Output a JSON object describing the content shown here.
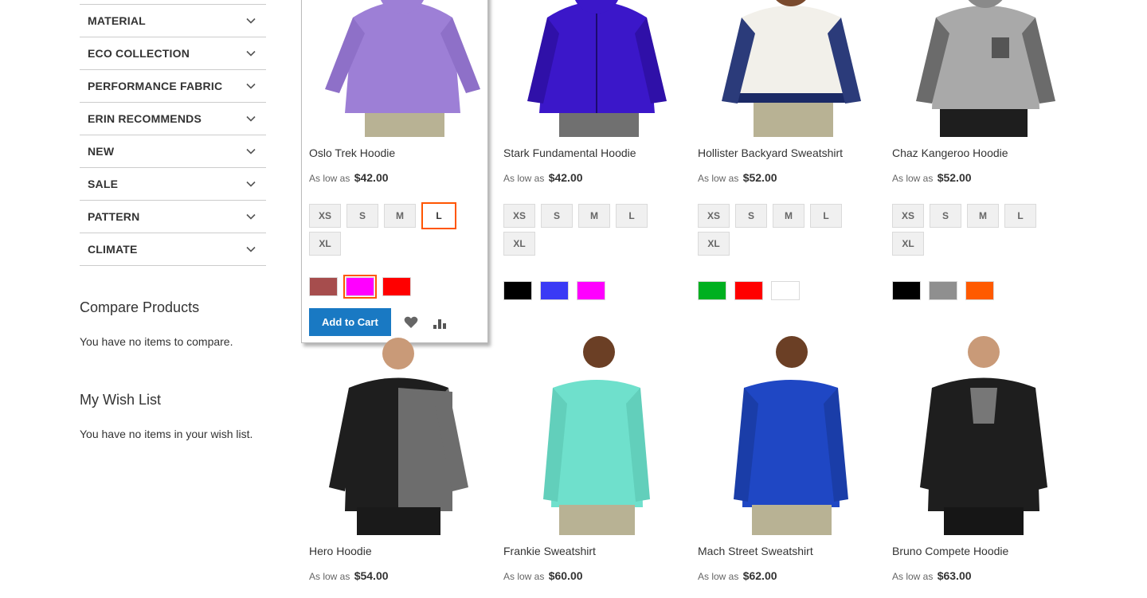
{
  "filters": [
    {
      "label": "MATERIAL"
    },
    {
      "label": "ECO COLLECTION"
    },
    {
      "label": "PERFORMANCE FABRIC"
    },
    {
      "label": "ERIN RECOMMENDS"
    },
    {
      "label": "NEW"
    },
    {
      "label": "SALE"
    },
    {
      "label": "PATTERN"
    },
    {
      "label": "CLIMATE"
    }
  ],
  "compare": {
    "title": "Compare Products",
    "empty": "You have no items to compare."
  },
  "wishlist": {
    "title": "My Wish List",
    "empty": "You have no items in your wish list."
  },
  "price_prefix": "As low as",
  "add_to_cart_label": "Add to Cart",
  "sizes": [
    "XS",
    "S",
    "M",
    "L",
    "XL"
  ],
  "products_row1": [
    {
      "name": "Oslo Trek Hoodie",
      "price": "$42.00",
      "colors": [
        "#a64d4d",
        "#ff00ff",
        "#ff0000"
      ],
      "garment": "#9d7fd6",
      "selected_size": "L",
      "selected_color": 1
    },
    {
      "name": "Stark Fundamental Hoodie",
      "price": "$42.00",
      "colors": [
        "#000000",
        "#3a3af5",
        "#ff00ff"
      ],
      "garment": "#3b17c9"
    },
    {
      "name": "Hollister Backyard Sweatshirt",
      "price": "$52.00",
      "colors": [
        "#00b020",
        "#ff0000",
        "#ffffff"
      ],
      "garment": "#f2f0ea"
    },
    {
      "name": "Chaz Kangeroo Hoodie",
      "price": "$52.00",
      "colors": [
        "#000000",
        "#8f8f8f",
        "#ff5a00"
      ],
      "garment": "#a9a9a9"
    }
  ],
  "products_row2": [
    {
      "name": "Hero Hoodie",
      "price": "$54.00",
      "garment": "#6d6d6d"
    },
    {
      "name": "Frankie Sweatshirt",
      "price": "$60.00",
      "garment": "#6fe0cc"
    },
    {
      "name": "Mach Street Sweatshirt",
      "price": "$62.00",
      "garment": "#1f47c4"
    },
    {
      "name": "Bruno Compete Hoodie",
      "price": "$63.00",
      "garment": "#1e1e1e"
    }
  ]
}
